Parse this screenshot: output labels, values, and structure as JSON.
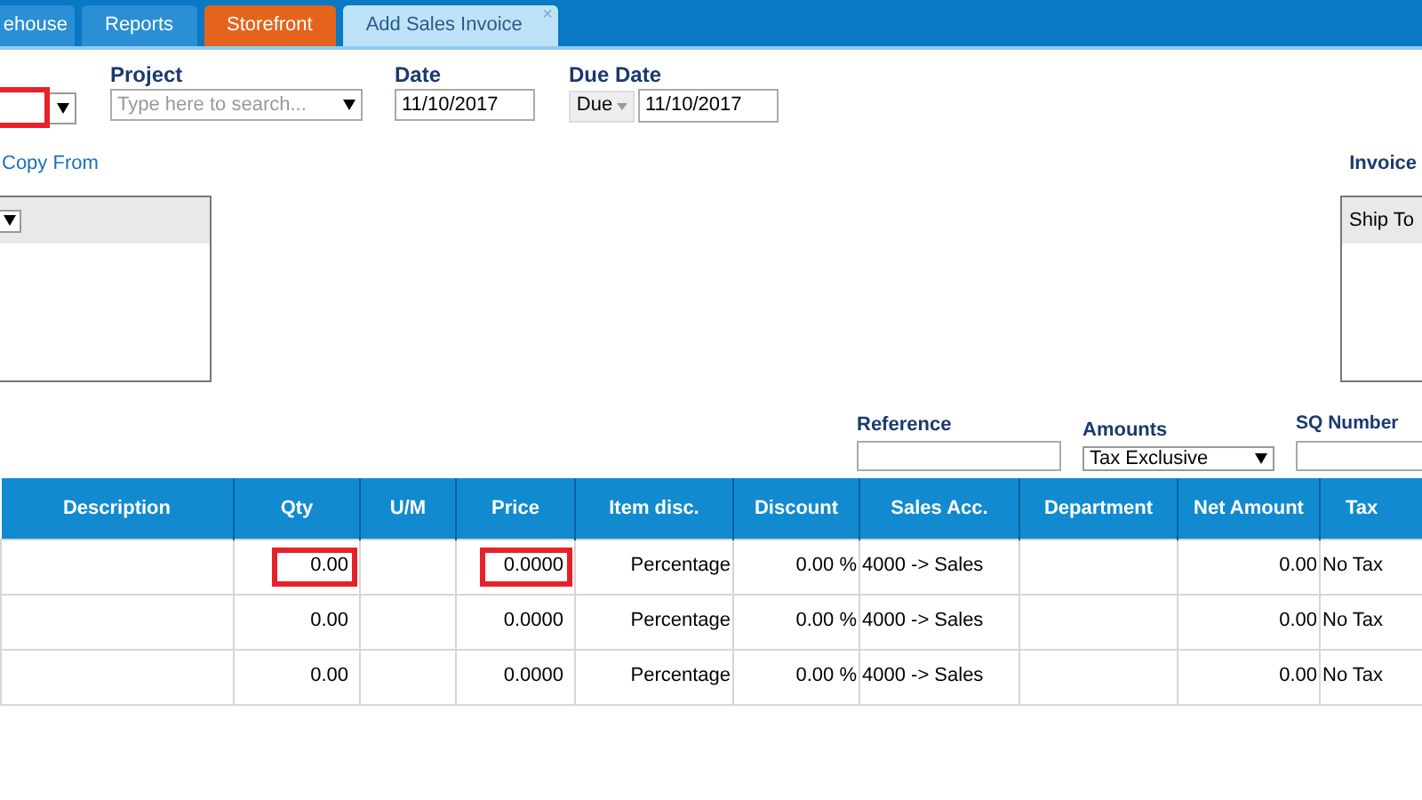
{
  "tabs": [
    {
      "label": "ehouse",
      "kind": "normal",
      "selected": false
    },
    {
      "label": "Reports",
      "kind": "normal",
      "selected": false
    },
    {
      "label": "Storefront",
      "kind": "accent",
      "selected": false
    },
    {
      "label": "Add Sales Invoice",
      "kind": "normal",
      "selected": true,
      "close": "×"
    }
  ],
  "header": {
    "customer": {
      "highlighted": true
    },
    "project": {
      "label": "Project",
      "placeholder": "Type here to search..."
    },
    "date": {
      "label": "Date",
      "value": "11/10/2017"
    },
    "due_date": {
      "label": "Due Date",
      "mode": "Due",
      "value": "11/10/2017"
    }
  },
  "copy_from": "Copy From",
  "invoice_label": "Invoice",
  "ship_to": "Ship To",
  "reference": {
    "label": "Reference"
  },
  "amounts": {
    "label": "Amounts",
    "value": "Tax Exclusive"
  },
  "sq_number": {
    "label": "SQ Number"
  },
  "table": {
    "columns": [
      "Description",
      "Qty",
      "U/M",
      "Price",
      "Item disc.",
      "Discount",
      "Sales Acc.",
      "Department",
      "Net Amount",
      "Tax"
    ],
    "rows": [
      {
        "qty": "0.00",
        "qty_highlighted": true,
        "price": "0.0000",
        "price_highlighted": true,
        "item_disc": "Percentage",
        "discount": "0.00 %",
        "sales_acc": "4000 -> Sales",
        "net_amount": "0.00",
        "tax": "No Tax"
      },
      {
        "qty": "0.00",
        "qty_highlighted": false,
        "price": "0.0000",
        "price_highlighted": false,
        "item_disc": "Percentage",
        "discount": "0.00 %",
        "sales_acc": "4000 -> Sales",
        "net_amount": "0.00",
        "tax": "No Tax"
      },
      {
        "qty": "0.00",
        "qty_highlighted": false,
        "price": "0.0000",
        "price_highlighted": false,
        "item_disc": "Percentage",
        "discount": "0.00 %",
        "sales_acc": "4000 -> Sales",
        "net_amount": "0.00",
        "tax": "No Tax"
      }
    ]
  }
}
